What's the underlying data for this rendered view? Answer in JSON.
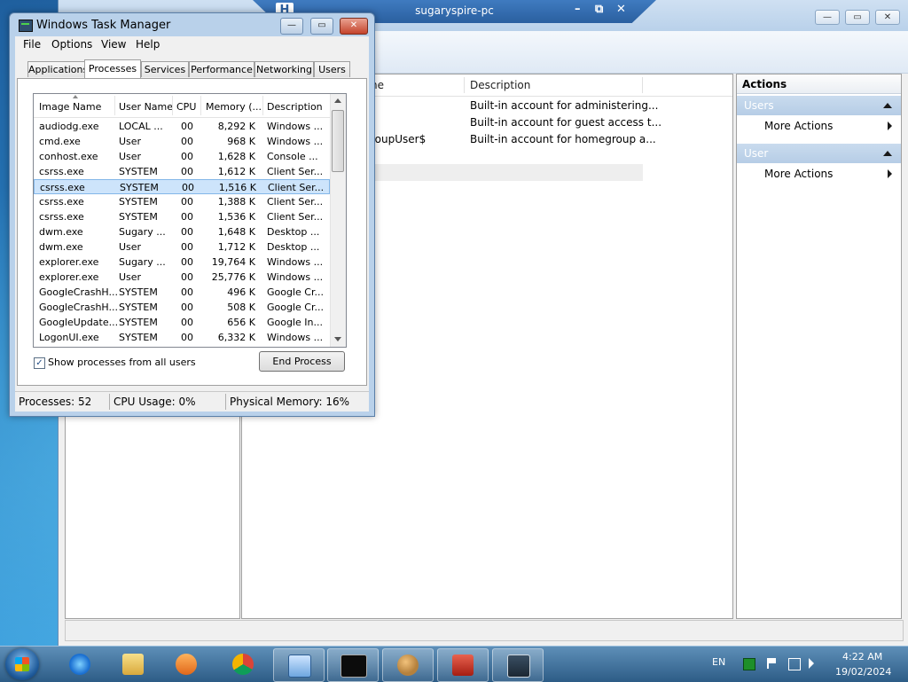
{
  "remote_bar": {
    "title": "sugaryspire-pc",
    "pin_label": "H",
    "min": "–",
    "restore": "⧉",
    "close": "✕"
  },
  "mgmt": {
    "columns": {
      "name": "ne",
      "description": "Description"
    },
    "rows": [
      {
        "name": "",
        "description": "Built-in account for administering..."
      },
      {
        "name": "",
        "description": "Built-in account for guest access t..."
      },
      {
        "name": "roupUser$",
        "description": "Built-in account for homegroup a..."
      }
    ],
    "actions": {
      "title": "Actions",
      "groups": [
        {
          "label": "Users",
          "item": "More Actions"
        },
        {
          "label": "User",
          "item": "More Actions"
        }
      ]
    },
    "window_controls": {
      "min": "—",
      "max": "▭",
      "close": "✕"
    }
  },
  "task_manager": {
    "title": "Windows Task Manager",
    "controls": {
      "min": "—",
      "max": "▭",
      "close": "✕"
    },
    "menu": [
      "File",
      "Options",
      "View",
      "Help"
    ],
    "tabs": [
      "Applications",
      "Processes",
      "Services",
      "Performance",
      "Networking",
      "Users"
    ],
    "active_tab": "Processes",
    "columns": [
      "Image Name",
      "User Name",
      "CPU",
      "Memory (...",
      "Description"
    ],
    "processes": [
      {
        "image": "audiodg.exe",
        "user": "LOCAL ...",
        "cpu": "00",
        "mem": "8,292 K",
        "desc": "Windows ..."
      },
      {
        "image": "cmd.exe",
        "user": "User",
        "cpu": "00",
        "mem": "968 K",
        "desc": "Windows ..."
      },
      {
        "image": "conhost.exe",
        "user": "User",
        "cpu": "00",
        "mem": "1,628 K",
        "desc": "Console ..."
      },
      {
        "image": "csrss.exe",
        "user": "SYSTEM",
        "cpu": "00",
        "mem": "1,612 K",
        "desc": "Client Ser..."
      },
      {
        "image": "csrss.exe",
        "user": "SYSTEM",
        "cpu": "00",
        "mem": "1,516 K",
        "desc": "Client Ser..."
      },
      {
        "image": "csrss.exe",
        "user": "SYSTEM",
        "cpu": "00",
        "mem": "1,388 K",
        "desc": "Client Ser..."
      },
      {
        "image": "csrss.exe",
        "user": "SYSTEM",
        "cpu": "00",
        "mem": "1,536 K",
        "desc": "Client Ser..."
      },
      {
        "image": "dwm.exe",
        "user": "Sugary ...",
        "cpu": "00",
        "mem": "1,648 K",
        "desc": "Desktop ..."
      },
      {
        "image": "dwm.exe",
        "user": "User",
        "cpu": "00",
        "mem": "1,712 K",
        "desc": "Desktop ..."
      },
      {
        "image": "explorer.exe",
        "user": "Sugary ...",
        "cpu": "00",
        "mem": "19,764 K",
        "desc": "Windows ..."
      },
      {
        "image": "explorer.exe",
        "user": "User",
        "cpu": "00",
        "mem": "25,776 K",
        "desc": "Windows ..."
      },
      {
        "image": "GoogleCrashH...",
        "user": "SYSTEM",
        "cpu": "00",
        "mem": "496 K",
        "desc": "Google Cr..."
      },
      {
        "image": "GoogleCrashH...",
        "user": "SYSTEM",
        "cpu": "00",
        "mem": "508 K",
        "desc": "Google Cr..."
      },
      {
        "image": "GoogleUpdate...",
        "user": "SYSTEM",
        "cpu": "00",
        "mem": "656 K",
        "desc": "Google In..."
      },
      {
        "image": "LogonUI.exe",
        "user": "SYSTEM",
        "cpu": "00",
        "mem": "6,332 K",
        "desc": "Windows ..."
      }
    ],
    "selected_row": 4,
    "show_all_users": {
      "label": "Show processes from all users",
      "checked": "✓"
    },
    "end_process_label": "End Process",
    "status": {
      "processes": "Processes: 52",
      "cpu": "CPU Usage: 0%",
      "memory": "Physical Memory: 16%"
    }
  },
  "taskbar": {
    "apps": [
      "internet-explorer",
      "windows-explorer",
      "media-player",
      "chrome",
      "computer-management",
      "command-prompt",
      "users-tool",
      "toolbox",
      "task-manager"
    ],
    "language": "EN",
    "time": "4:22 AM",
    "date": "19/02/2024"
  }
}
